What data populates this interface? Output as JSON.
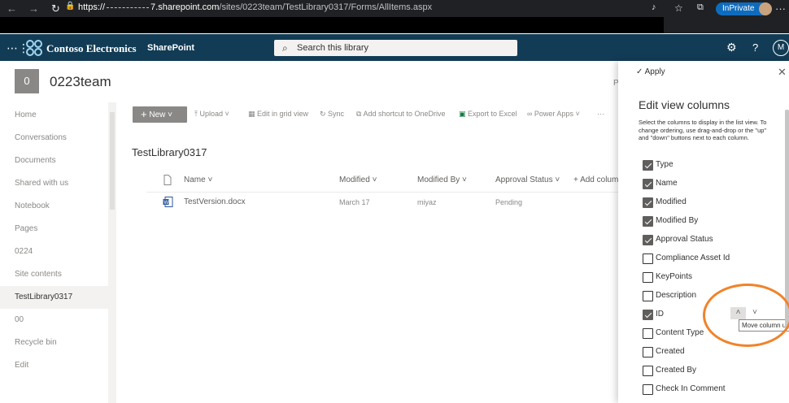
{
  "browser": {
    "url_scheme": "https://",
    "url_host_suffix": "7.sharepoint.com",
    "url_path": "/sites/0223team/TestLibrary0317/Forms/AllItems.aspx",
    "inprivate_label": "InPrivate",
    "more_label": "···"
  },
  "suite": {
    "org_name": "Contoso Electronics",
    "app_name": "SharePoint",
    "search_placeholder": "Search this library",
    "help_label": "?",
    "me_initial": "M"
  },
  "site": {
    "icon_letter": "0",
    "title": "0223team",
    "right_flag": "P"
  },
  "leftnav": {
    "items": [
      {
        "label": "Home"
      },
      {
        "label": "Conversations"
      },
      {
        "label": "Documents"
      },
      {
        "label": "Shared with us"
      },
      {
        "label": "Notebook"
      },
      {
        "label": "Pages"
      },
      {
        "label": "0224"
      },
      {
        "label": "Site contents"
      },
      {
        "label": "TestLibrary0317"
      },
      {
        "label": "00"
      },
      {
        "label": "Recycle bin"
      },
      {
        "label": "Edit"
      }
    ],
    "active_index": 8
  },
  "commands": {
    "new": "New",
    "upload": "Upload",
    "grid": "Edit in grid view",
    "sync": "Sync",
    "shortcut": "Add shortcut to OneDrive",
    "excel": "Export to Excel",
    "powerapps": "Power Apps",
    "more": "···"
  },
  "library": {
    "title": "TestLibrary0317",
    "columns": {
      "name": "Name",
      "modified": "Modified",
      "modified_by": "Modified By",
      "approval": "Approval Status",
      "add": "+ Add column"
    },
    "rows": [
      {
        "name": "TestVersion.docx",
        "modified": "March 17",
        "modified_by": "miyaz",
        "approval": "Pending"
      }
    ]
  },
  "panel": {
    "apply": "Apply",
    "title": "Edit view columns",
    "description": "Select the columns to display in the list view. To ordering, use drag-and-drop or the \"up\" and \"down\" buttons next to each column.",
    "description_full": "Select the columns to display in the list view. To change ordering, use drag-and-drop or the \"up\" and \"down\" buttons next to each column.",
    "columns": [
      {
        "label": "Type",
        "checked": true
      },
      {
        "label": "Name",
        "checked": true
      },
      {
        "label": "Modified",
        "checked": true
      },
      {
        "label": "Modified By",
        "checked": true
      },
      {
        "label": "Approval Status",
        "checked": true
      },
      {
        "label": "Compliance Asset Id",
        "checked": false
      },
      {
        "label": "KeyPoints",
        "checked": false
      },
      {
        "label": "Description",
        "checked": false
      },
      {
        "label": "ID",
        "checked": true
      },
      {
        "label": "Content Type",
        "checked": false
      },
      {
        "label": "Created",
        "checked": false
      },
      {
        "label": "Created By",
        "checked": false
      },
      {
        "label": "Check In Comment",
        "checked": false
      }
    ],
    "tooltip": "Move column up"
  },
  "colors": {
    "suite_bar": "#123c55",
    "browser_bar": "#202124",
    "inprivate": "#0f6cbd",
    "highlight_ring": "#f0832b",
    "checkbox_on": "#605e5c"
  }
}
